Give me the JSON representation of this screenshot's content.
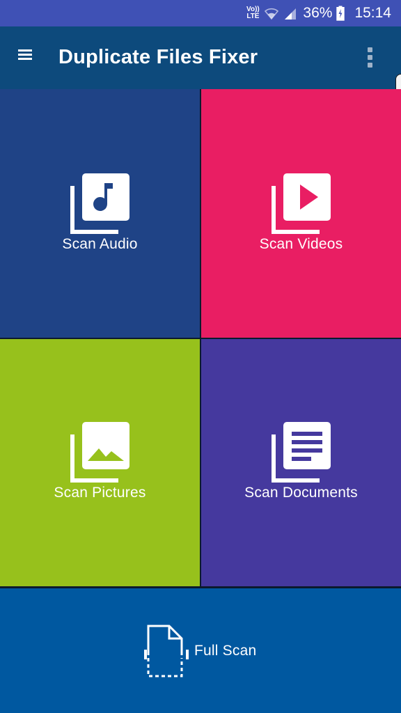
{
  "status_bar": {
    "network_badge_top": "Vo))",
    "network_badge_bottom": "LTE",
    "battery_percent": "36%",
    "time": "15:14",
    "icons": [
      "volte-icon",
      "wifi-icon",
      "signal-icon",
      "battery-charging-icon"
    ]
  },
  "app_bar": {
    "title": "Duplicate Files Fixer",
    "menu_icon": "hamburger-menu-icon",
    "overflow_icon": "more-vert-icon"
  },
  "tiles": [
    {
      "label": "Scan Audio",
      "icon": "audio-library-icon",
      "color": "#1f4386"
    },
    {
      "label": "Scan Videos",
      "icon": "video-library-icon",
      "color": "#e91e63"
    },
    {
      "label": "Scan Pictures",
      "icon": "photo-library-icon",
      "color": "#97c11c"
    },
    {
      "label": "Scan Documents",
      "icon": "document-library-icon",
      "color": "#45399e"
    }
  ],
  "full_scan": {
    "label": "Full Scan",
    "icon": "scan-document-icon",
    "color": "#0058a0"
  },
  "colors": {
    "status_bar": "#3f51b5",
    "app_bar": "#0d4a7c",
    "divider": "#0b1a2e"
  }
}
